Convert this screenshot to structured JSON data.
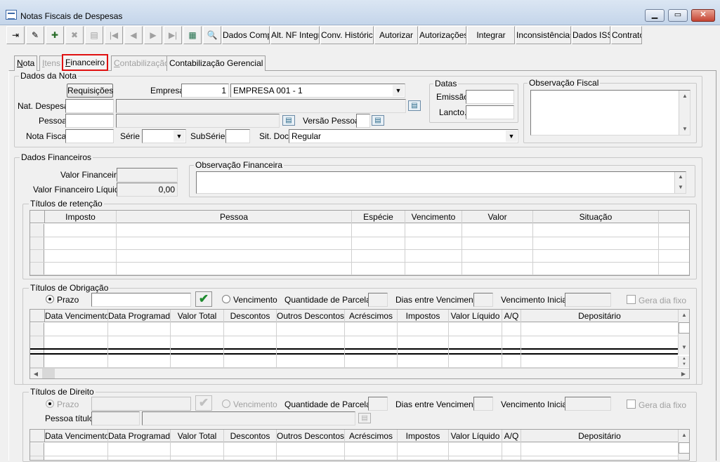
{
  "window": {
    "title": "Notas Fiscais de Despesas"
  },
  "toolbar": {
    "icons": [
      "exit-icon",
      "edit-icon",
      "add-icon",
      "delete-icon",
      "print-icon",
      "first-icon",
      "prev-icon",
      "next-icon",
      "last-icon",
      "grid-icon",
      "find-icon"
    ],
    "buttons": [
      "Dados Comp.",
      "Alt. NF Integr.",
      "Conv. Histórico",
      "Autorizar",
      "Autorizações",
      "Integrar",
      "Inconsistências",
      "Dados ISS",
      "Contrato"
    ]
  },
  "tabs": [
    "Nota",
    "Itens",
    "Financeiro",
    "Contabilização",
    "Contabilização Gerencial"
  ],
  "dados_nota": {
    "legend": "Dados da Nota",
    "requisicoes": "Requisições",
    "empresa_label": "Empresa",
    "empresa_code": "1",
    "empresa_name": "EMPRESA 001 - 1",
    "nat_despesa_label": "Nat. Despesa",
    "pessoa_label": "Pessoa",
    "versao_pessoa_label": "Versão Pessoa",
    "nota_fiscal_label": "Nota Fiscal",
    "serie_label": "Série",
    "subserie_label": "SubSérie",
    "sit_doc_label": "Sit. Doc.",
    "sit_doc_value": "Regular",
    "datas_legend": "Datas",
    "emissao_label": "Emissão",
    "lancto_label": "Lancto.",
    "obs_fiscal_legend": "Observação Fiscal"
  },
  "dados_financeiros": {
    "legend": "Dados Financeiros",
    "valor_financeiro_label": "Valor Financeiro",
    "valor_liquido_label": "Valor Financeiro Líquido",
    "valor_liquido": "0,00",
    "obs_financeira_legend": "Observação Financeira"
  },
  "retencao": {
    "legend": "Títulos de retenção",
    "columns": [
      "Imposto",
      "Pessoa",
      "Espécie",
      "Vencimento",
      "Valor",
      "Situação"
    ]
  },
  "obrigacao": {
    "legend": "Títulos de Obrigação",
    "prazo": "Prazo",
    "vencimento": "Vencimento",
    "qtd_parcelas": "Quantidade de Parcelas:",
    "dias_entre": "Dias entre Vencimento:",
    "venc_inicial": "Vencimento Inicial:",
    "gera_dia_fixo": "Gera dia fixo",
    "columns": [
      "Data Vencimento",
      "Data Programada",
      "Valor Total",
      "Descontos",
      "Outros Descontos",
      "Acréscimos",
      "Impostos",
      "Valor Líquido",
      "A/Q",
      "Depositário"
    ]
  },
  "direito": {
    "legend": "Títulos de Direito",
    "prazo": "Prazo",
    "vencimento": "Vencimento",
    "qtd_parcelas": "Quantidade de Parcelas:",
    "dias_entre": "Dias entre Vencimento:",
    "venc_inicial": "Vencimento Inicial:",
    "gera_dia_fixo": "Gera dia fixo",
    "pessoa_titulo": "Pessoa título",
    "columns": [
      "Data Vencimento",
      "Data Programada",
      "Valor Total",
      "Descontos",
      "Outros Descontos",
      "Acréscimos",
      "Impostos",
      "Valor Líquido",
      "A/Q",
      "Depositário"
    ]
  }
}
